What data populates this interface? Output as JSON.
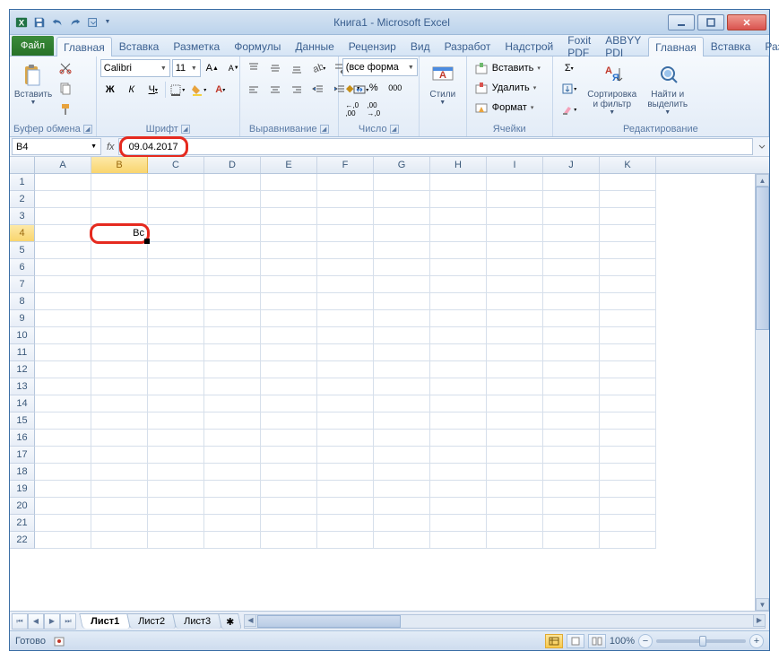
{
  "title": "Книга1 - Microsoft Excel",
  "tabs": {
    "file": "Файл",
    "items": [
      "Главная",
      "Вставка",
      "Разметка",
      "Формулы",
      "Данные",
      "Рецензир",
      "Вид",
      "Разработ",
      "Надстрой",
      "Foxit PDF",
      "ABBYY PDI"
    ],
    "active": 0
  },
  "ribbon": {
    "clipboard": {
      "paste": "Вставить",
      "title": "Буфер обмена"
    },
    "font": {
      "name": "Calibri",
      "size": "11",
      "title": "Шрифт"
    },
    "align": {
      "title": "Выравнивание"
    },
    "number": {
      "format": "(все форма",
      "title": "Число"
    },
    "styles": {
      "btn": "Стили",
      "title": ""
    },
    "cells": {
      "insert": "Вставить",
      "delete": "Удалить",
      "format": "Формат",
      "title": "Ячейки"
    },
    "editing": {
      "sort": "Сортировка\nи фильтр",
      "find": "Найти и\nвыделить",
      "title": "Редактирование"
    }
  },
  "namebox": "B4",
  "formula": "09.04.2017",
  "columns": [
    "A",
    "B",
    "C",
    "D",
    "E",
    "F",
    "G",
    "H",
    "I",
    "J",
    "K"
  ],
  "sel_col": "B",
  "sel_row": 4,
  "row_count": 22,
  "cells": {
    "B4": "Вс"
  },
  "sheets": {
    "items": [
      "Лист1",
      "Лист2",
      "Лист3"
    ],
    "active": 0
  },
  "status": {
    "ready": "Готово",
    "zoom": "100%"
  }
}
